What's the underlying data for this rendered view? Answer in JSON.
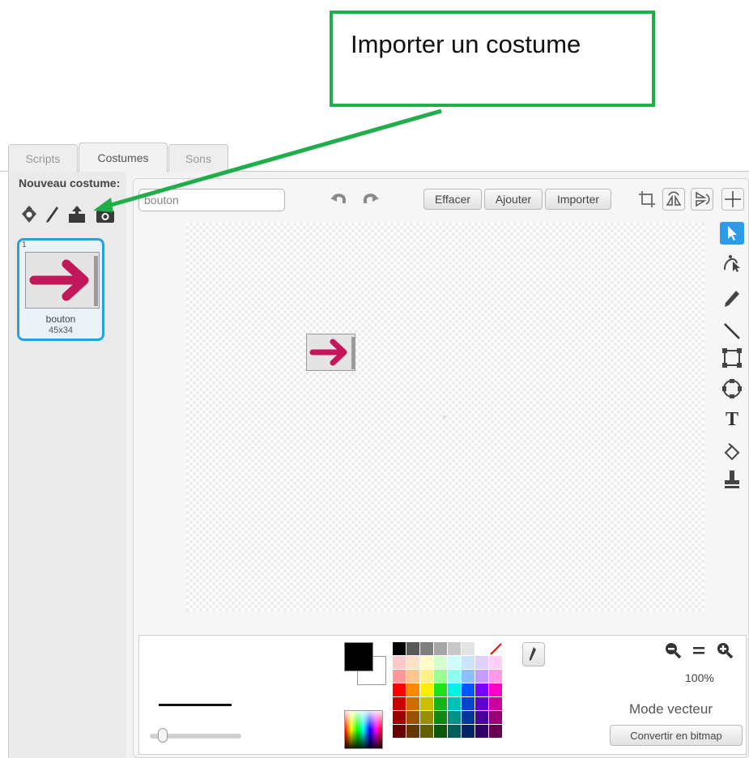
{
  "callout": {
    "text": "Importer un costume"
  },
  "tabs": [
    {
      "label": "Scripts",
      "active": false
    },
    {
      "label": "Costumes",
      "active": true
    },
    {
      "label": "Sons",
      "active": false
    }
  ],
  "sidebar": {
    "new_costume_label": "Nouveau costume:",
    "tools": [
      "sprite-library-icon",
      "paint-brush-icon",
      "upload-icon",
      "camera-icon"
    ],
    "costumes": [
      {
        "index": "1",
        "name": "bouton",
        "size": "45x34",
        "selected": true
      }
    ]
  },
  "editor": {
    "name_value": "bouton",
    "buttons": {
      "clear": "Effacer",
      "add": "Ajouter",
      "import": "Importer"
    },
    "zoom": "100%",
    "mode_label": "Mode vecteur",
    "convert_label": "Convertir en bitmap"
  },
  "colors": {
    "accent": "#29a0e0",
    "arrow": "#c2185b",
    "callout_border": "#1fae4a",
    "foreground": "#000000",
    "background": "#ffffff",
    "palette": [
      "#000000",
      "#595959",
      "#7f7f7f",
      "#a5a5a5",
      "#c8c8c8",
      "#e4e4e4",
      "#ffffff",
      "none",
      "#ffc9c9",
      "#ffe2c7",
      "#fffac7",
      "#d6ffd0",
      "#ccfff9",
      "#cce3ff",
      "#e0d0ff",
      "#ffd0f3",
      "#ff9999",
      "#ffc58f",
      "#fff185",
      "#9dff93",
      "#8cffef",
      "#8ebeff",
      "#c49dff",
      "#ff9be6",
      "#ff0000",
      "#ff8a00",
      "#ffee00",
      "#1fe21f",
      "#00f3e4",
      "#0057ff",
      "#7a00ff",
      "#ff00c8",
      "#cc0000",
      "#cc6f00",
      "#ccbe00",
      "#17b417",
      "#00c1b6",
      "#0046cc",
      "#6200cc",
      "#cc00a0",
      "#990000",
      "#995300",
      "#998f00",
      "#118811",
      "#009189",
      "#003599",
      "#490099",
      "#990078",
      "#660000",
      "#663700",
      "#665f00",
      "#0b5a0b",
      "#00605b",
      "#002366",
      "#310066",
      "#660050"
    ]
  }
}
